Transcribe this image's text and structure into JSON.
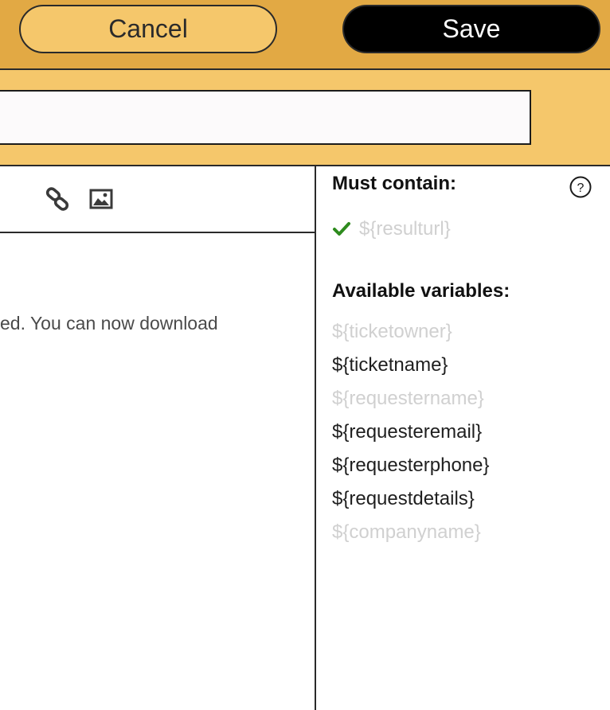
{
  "header": {
    "cancel_label": "Cancel",
    "save_label": "Save"
  },
  "subject": {
    "value": ""
  },
  "editor": {
    "toolbar": {
      "icons": [
        "link-icon",
        "image-icon"
      ]
    },
    "body_text": "ed. You can now download"
  },
  "sidebar": {
    "must_contain_title": "Must contain:",
    "must_contain": [
      {
        "label": "${resulturl}",
        "satisfied": true
      }
    ],
    "available_title": "Available variables:",
    "variables": [
      {
        "label": "${ticketowner}",
        "used": false
      },
      {
        "label": "${ticketname}",
        "used": true
      },
      {
        "label": "${requestername}",
        "used": false
      },
      {
        "label": "${requesteremail}",
        "used": true
      },
      {
        "label": "${requesterphone}",
        "used": true
      },
      {
        "label": "${requestdetails}",
        "used": true
      },
      {
        "label": "${companyname}",
        "used": false
      }
    ]
  },
  "colors": {
    "header_bg": "#e2a944",
    "subbar_bg": "#f5c76b",
    "check_green": "#2e8b1e",
    "muted_text": "#d0d0d0"
  }
}
